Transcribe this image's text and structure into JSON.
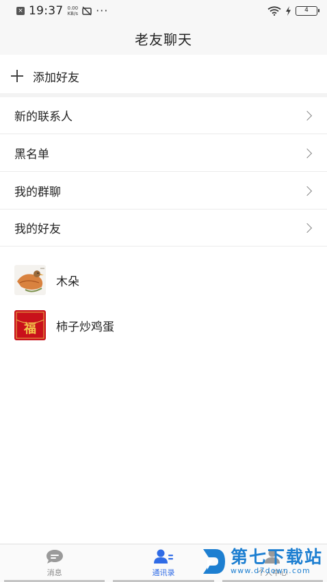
{
  "status_bar": {
    "time": "19:37",
    "speed_value": "0.00",
    "speed_unit": "KB/s",
    "dots": "···",
    "battery": "4"
  },
  "header": {
    "title": "老友聊天"
  },
  "add_friend": {
    "label": "添加好友"
  },
  "menu": {
    "items": [
      {
        "label": "新的联系人"
      },
      {
        "label": "黑名单"
      },
      {
        "label": "我的群聊"
      },
      {
        "label": "我的好友"
      }
    ]
  },
  "contacts": [
    {
      "name": "木朵",
      "avatar_icon": "bird-on-leaf-image"
    },
    {
      "name": "柿子炒鸡蛋",
      "avatar_icon": "fu-red-envelope-image",
      "avatar_text": "福"
    }
  ],
  "tabs": [
    {
      "label": "消息",
      "icon": "chat-bubble-icon",
      "active": false
    },
    {
      "label": "通讯录",
      "icon": "contacts-icon",
      "active": true
    },
    {
      "label": "个人中心",
      "icon": "person-icon",
      "active": false
    }
  ],
  "watermark": {
    "title": "第七下载站",
    "url": "www.d7down.com"
  },
  "colors": {
    "accent": "#2f6be6",
    "header_bg": "#f7f7f7",
    "divider": "#ebebeb",
    "watermark": "#1d7fd1"
  }
}
